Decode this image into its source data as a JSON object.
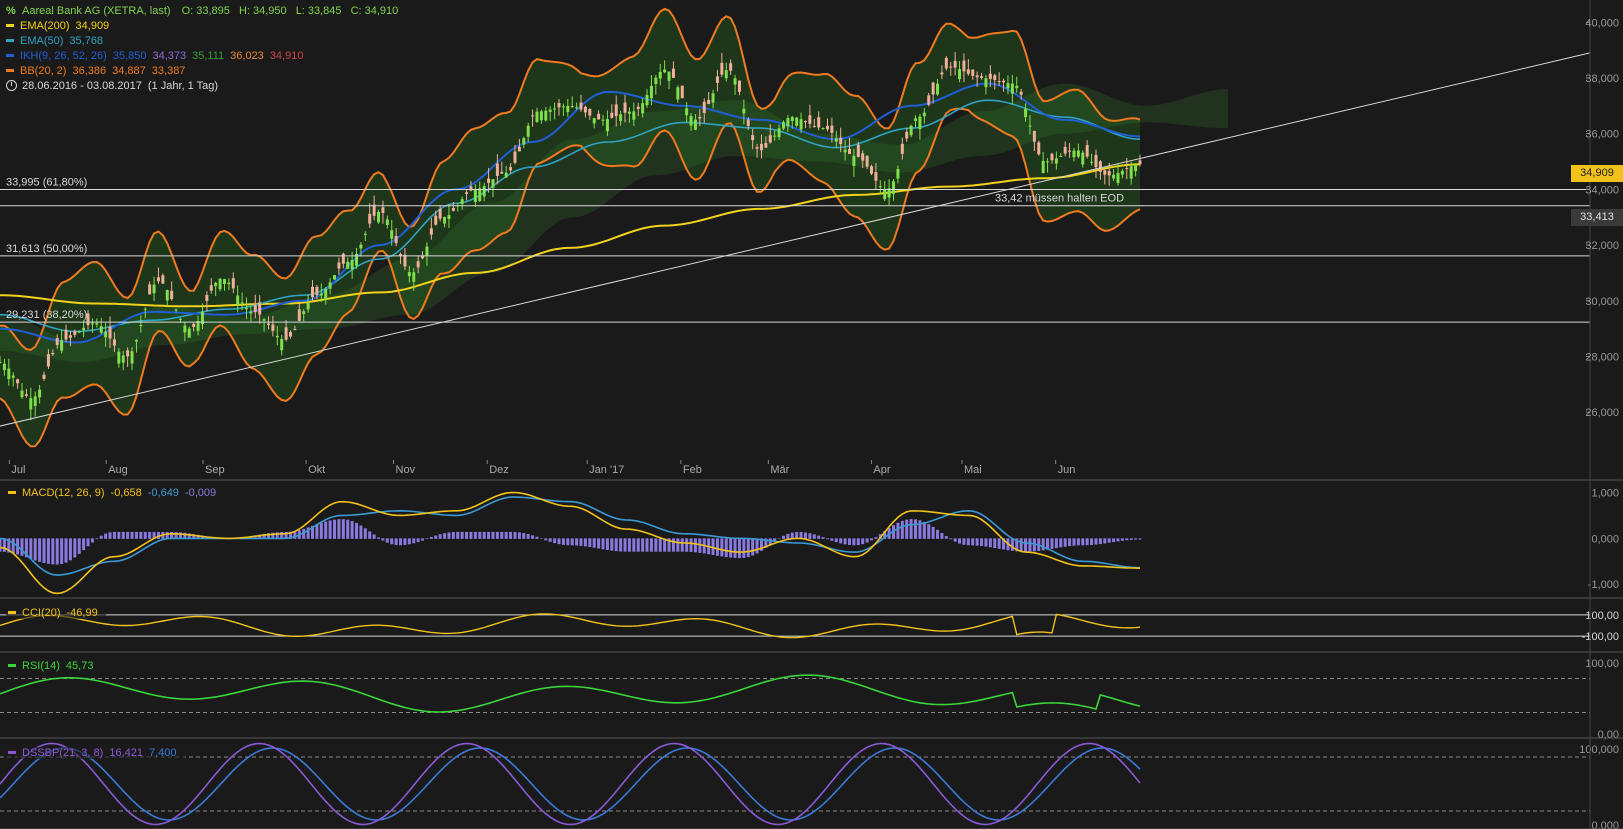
{
  "header": {
    "instrument": "Aareal Bank AG (XETRA, last)",
    "ohlc": [
      {
        "label": "O:",
        "value": "33,895"
      },
      {
        "label": "H:",
        "value": "34,950"
      },
      {
        "label": "L:",
        "value": "33,845"
      },
      {
        "label": "C:",
        "value": "34,910"
      }
    ],
    "indicators": [
      {
        "name": "EMA(200)",
        "values": [
          "34,909"
        ],
        "color": "#f2d21b",
        "value_colors": [
          "#f2d21b"
        ]
      },
      {
        "name": "EMA(50)",
        "values": [
          "35,768"
        ],
        "color": "#2fa3c4",
        "value_colors": [
          "#2fa3c4"
        ]
      },
      {
        "name": "IKH(9, 26, 52, 26)",
        "values": [
          "35,850",
          "34,373",
          "35,111",
          "36,023",
          "34,910"
        ],
        "color": "#1f5fd6",
        "value_colors": [
          "#1f5fd6",
          "#8a6bd6",
          "#3a9a3a",
          "#e8873a",
          "#d04040"
        ]
      },
      {
        "name": "BB(20, 2)",
        "values": [
          "36,386",
          "34,887",
          "33,387"
        ],
        "color": "#f07a1e",
        "value_colors": [
          "#f07a1e",
          "#f07a1e",
          "#f07a1e"
        ]
      }
    ],
    "period": "28.06.2016 - 03.08.2017",
    "period_note": "(1 Jahr, 1 Tag)"
  },
  "price_boxes": {
    "last": {
      "text": "34,909",
      "bg": "#f2c21b",
      "fg": "#1a1a1a"
    },
    "support": {
      "text": "33,413",
      "bg": "#3a3a3a",
      "fg": "#e0e0e0"
    }
  },
  "annotations": {
    "fib_618": "33,995 (61,80%)",
    "fib_50": "31,613 (50,00%)",
    "fib_382": "29,231 (38,20%)",
    "support_note": "33,42 müssen halten EOD"
  },
  "subpanels": {
    "macd": {
      "name": "MACD(12, 26, 9)",
      "values": [
        "-0,658",
        "-0,649",
        "-0,009"
      ],
      "colors": [
        "#f2c21b",
        "#3a9ad6",
        "#8a7ae0"
      ]
    },
    "cci": {
      "name": "CCI(20)",
      "values": [
        "-46,99"
      ],
      "colors": [
        "#f2c21b"
      ]
    },
    "rsi": {
      "name": "RSI(14)",
      "values": [
        "45,73"
      ],
      "colors": [
        "#3ad63a"
      ]
    },
    "dssbp": {
      "name": "DSSBP(21, 3, 8)",
      "values": [
        "16,421",
        "7,400"
      ],
      "colors": [
        "#8a5ad6",
        "#3a7ad6"
      ]
    }
  },
  "chart_data": [
    {
      "type": "candlestick",
      "title": "Aareal Bank AG (XETRA, last)",
      "ylim": [
        25,
        40.8
      ],
      "y_ticks": [
        "26,000",
        "28,000",
        "30,000",
        "32,000",
        "34,000",
        "36,000",
        "38,000",
        "40,000"
      ],
      "x_ticks": [
        "Jul",
        "Aug",
        "Sep",
        "Okt",
        "Nov",
        "Dez",
        "Jan '17",
        "Feb",
        "Mär",
        "Apr",
        "Mai",
        "Jun"
      ],
      "close_approx": [
        {
          "x": "2016-06-28",
          "y": 27.8
        },
        {
          "x": "2016-07-08",
          "y": 26.5
        },
        {
          "x": "2016-07-15",
          "y": 28.6
        },
        {
          "x": "2016-07-29",
          "y": 29.2
        },
        {
          "x": "2016-08-05",
          "y": 28.0
        },
        {
          "x": "2016-08-12",
          "y": 30.7
        },
        {
          "x": "2016-08-26",
          "y": 29.0
        },
        {
          "x": "2016-09-09",
          "y": 30.8
        },
        {
          "x": "2016-09-23",
          "y": 29.6
        },
        {
          "x": "2016-10-03",
          "y": 28.6
        },
        {
          "x": "2016-10-14",
          "y": 30.2
        },
        {
          "x": "2016-10-28",
          "y": 31.4
        },
        {
          "x": "2016-11-04",
          "y": 33.2
        },
        {
          "x": "2016-11-11",
          "y": 31.0
        },
        {
          "x": "2016-11-18",
          "y": 33.0
        },
        {
          "x": "2016-11-25",
          "y": 34.0
        },
        {
          "x": "2016-12-02",
          "y": 34.6
        },
        {
          "x": "2016-12-09",
          "y": 36.8
        },
        {
          "x": "2016-12-23",
          "y": 37.0
        },
        {
          "x": "2017-01-06",
          "y": 36.5
        },
        {
          "x": "2017-01-20",
          "y": 36.8
        },
        {
          "x": "2017-02-01",
          "y": 38.3
        },
        {
          "x": "2017-02-10",
          "y": 36.5
        },
        {
          "x": "2017-02-24",
          "y": 38.3
        },
        {
          "x": "2017-03-03",
          "y": 35.4
        },
        {
          "x": "2017-03-10",
          "y": 36.6
        },
        {
          "x": "2017-03-24",
          "y": 36.2
        },
        {
          "x": "2017-04-03",
          "y": 35.2
        },
        {
          "x": "2017-04-13",
          "y": 34.0
        },
        {
          "x": "2017-04-28",
          "y": 36.6
        },
        {
          "x": "2017-05-12",
          "y": 38.4
        },
        {
          "x": "2017-05-26",
          "y": 38.0
        },
        {
          "x": "2017-06-02",
          "y": 37.8
        },
        {
          "x": "2017-06-09",
          "y": 35.0
        },
        {
          "x": "2017-06-16",
          "y": 35.4
        },
        {
          "x": "2017-06-23",
          "y": 34.5
        },
        {
          "x": "2017-06-28",
          "y": 34.9
        }
      ],
      "horizontal_levels": [
        {
          "label": "33,995 (61,80%)",
          "y": 33.995
        },
        {
          "label": "31,613 (50,00%)",
          "y": 31.613
        },
        {
          "label": "29,231 (38,20%)",
          "y": 29.231
        },
        {
          "label": "33,413",
          "y": 33.413
        }
      ]
    },
    {
      "type": "line",
      "title": "MACD(12, 26, 9)",
      "y_ticks": [
        "1,000",
        "0,000",
        "-1,000"
      ],
      "ylim": [
        -1.3,
        1.25
      ]
    },
    {
      "type": "line",
      "title": "CCI(20)",
      "y_ticks": [
        "100,00",
        "-100,00"
      ]
    },
    {
      "type": "line",
      "title": "RSI(14)",
      "y_ticks": [
        "100,00",
        "0,00"
      ],
      "ylim": [
        0,
        100
      ]
    },
    {
      "type": "line",
      "title": "DSSBP(21, 3, 8)",
      "y_ticks": [
        "100,000",
        "0,000"
      ],
      "ylim": [
        0,
        100
      ]
    }
  ]
}
